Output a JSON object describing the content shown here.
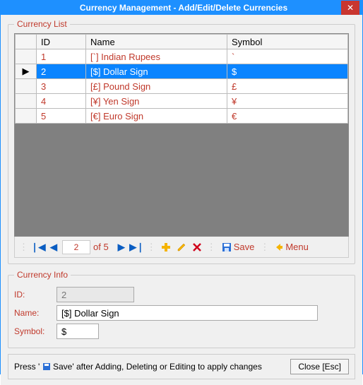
{
  "window": {
    "title": "Currency Management - Add/Edit/Delete Currencies"
  },
  "list": {
    "legend": "Currency List",
    "columns": {
      "id": "ID",
      "name": "Name",
      "symbol": "Symbol"
    },
    "rows": [
      {
        "id": "1",
        "name": "[`] Indian Rupees",
        "symbol": "`",
        "selected": false
      },
      {
        "id": "2",
        "name": "[$] Dollar Sign",
        "symbol": "$",
        "selected": true
      },
      {
        "id": "3",
        "name": "[£] Pound Sign",
        "symbol": "£",
        "selected": false
      },
      {
        "id": "4",
        "name": "[¥] Yen Sign",
        "symbol": "¥",
        "selected": false
      },
      {
        "id": "5",
        "name": "[€] Euro Sign",
        "symbol": "€",
        "selected": false
      }
    ]
  },
  "nav": {
    "position": "2",
    "of_label": "of 5",
    "save_label": "Save",
    "menu_label": "Menu"
  },
  "info": {
    "legend": "Currency Info",
    "id_label": "ID:",
    "id_value": "2",
    "name_label": "Name:",
    "name_value": "[$] Dollar Sign",
    "symbol_label": "Symbol:",
    "symbol_value": "$"
  },
  "footer": {
    "hint_prefix": "Press '",
    "hint_rest": "Save' after Adding, Deleting or Editing to apply changes",
    "close_label": "Close [Esc]"
  }
}
